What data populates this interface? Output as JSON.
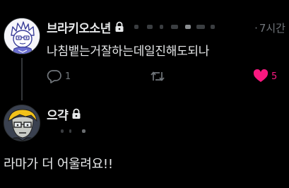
{
  "tweets": [
    {
      "display_name": "브라키오소년",
      "protected_icon": "lock-icon",
      "time": "7시간",
      "time_separator": "·",
      "text": "나침뱉는거잘하는데일진해도되나",
      "avatar_icon": "cartoon-boy-avatar",
      "actions": {
        "reply_icon": "reply-bubble-icon",
        "reply_count": "1",
        "retweet_icon": "retweet-icon",
        "retweet_count": "",
        "like_icon": "heart-icon",
        "like_count": "5",
        "like_color": "#f91880"
      }
    },
    {
      "display_name": "으갹",
      "protected_icon": "lock-icon",
      "text": "라마가 더 어울려요!!",
      "avatar_icon": "cartoon-man-glasses-avatar"
    }
  ],
  "colors": {
    "background": "#000000",
    "primary_text": "#e7e9ea",
    "secondary_text": "#71767b",
    "thread_line": "#333639",
    "like_active": "#f91880"
  }
}
